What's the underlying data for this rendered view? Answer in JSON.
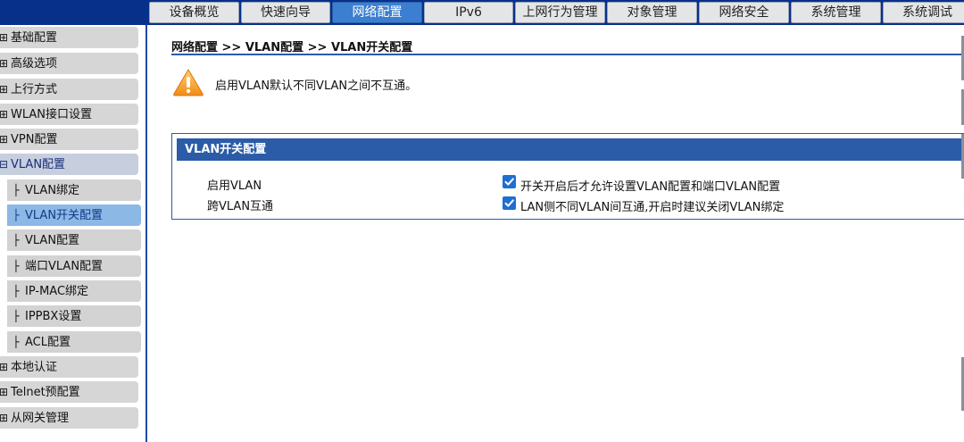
{
  "top_tabs": [
    {
      "label": "设备概览",
      "active": false
    },
    {
      "label": "快速向导",
      "active": false
    },
    {
      "label": "网络配置",
      "active": true
    },
    {
      "label": "IPv6",
      "active": false
    },
    {
      "label": "上网行为管理",
      "active": false
    },
    {
      "label": "对象管理",
      "active": false
    },
    {
      "label": "网络安全",
      "active": false
    },
    {
      "label": "系统管理",
      "active": false
    },
    {
      "label": "系统调试",
      "active": false
    }
  ],
  "sidebar": {
    "items": [
      {
        "label": "基础配置",
        "icon": "plus-box-icon"
      },
      {
        "label": "高级选项",
        "icon": "plus-box-icon"
      },
      {
        "label": "上行方式",
        "icon": "plus-box-icon"
      },
      {
        "label": "WLAN接口设置",
        "icon": "plus-box-icon"
      },
      {
        "label": "VPN配置",
        "icon": "plus-box-icon"
      },
      {
        "label": "VLAN配置",
        "icon": "minus-box-icon",
        "expanded": true
      },
      {
        "label": "本地认证",
        "icon": "plus-box-icon"
      },
      {
        "label": "Telnet预配置",
        "icon": "plus-box-icon"
      },
      {
        "label": "从网关管理",
        "icon": "plus-box-icon"
      }
    ],
    "sub_items": [
      {
        "label": "VLAN绑定",
        "icon": "tree-branch-icon",
        "selected": false
      },
      {
        "label": "VLAN开关配置",
        "icon": "tree-branch-icon",
        "selected": true
      },
      {
        "label": "VLAN配置",
        "icon": "tree-branch-icon",
        "selected": false
      },
      {
        "label": "端口VLAN配置",
        "icon": "tree-branch-icon",
        "selected": false
      },
      {
        "label": "IP-MAC绑定",
        "icon": "tree-branch-icon",
        "selected": false
      },
      {
        "label": "IPPBX设置",
        "icon": "tree-branch-icon",
        "selected": false
      },
      {
        "label": "ACL配置",
        "icon": "tree-branch-icon",
        "selected": false
      }
    ]
  },
  "breadcrumb": "网络配置 >> VLAN配置 >> VLAN开关配置",
  "notice": {
    "icon": "warning-triangle-icon",
    "text": "启用VLAN默认不同VLAN之间不互通。"
  },
  "panel": {
    "title": "VLAN开关配置",
    "rows": [
      {
        "label": "启用VLAN",
        "checked": true,
        "desc": "开关开启后才允许设置VLAN配置和端口VLAN配置"
      },
      {
        "label": "跨VLAN互通",
        "checked": true,
        "desc": "LAN侧不同VLAN间互通,开启时建议关闭VLAN绑定"
      }
    ]
  },
  "colors": {
    "topbar_bg": "#07308a",
    "active_tab": "#3c7fd0",
    "accent_blue": "#2a5ca8",
    "checkbox_blue": "#1f6fd1",
    "warning_orange": "#f5a623"
  }
}
